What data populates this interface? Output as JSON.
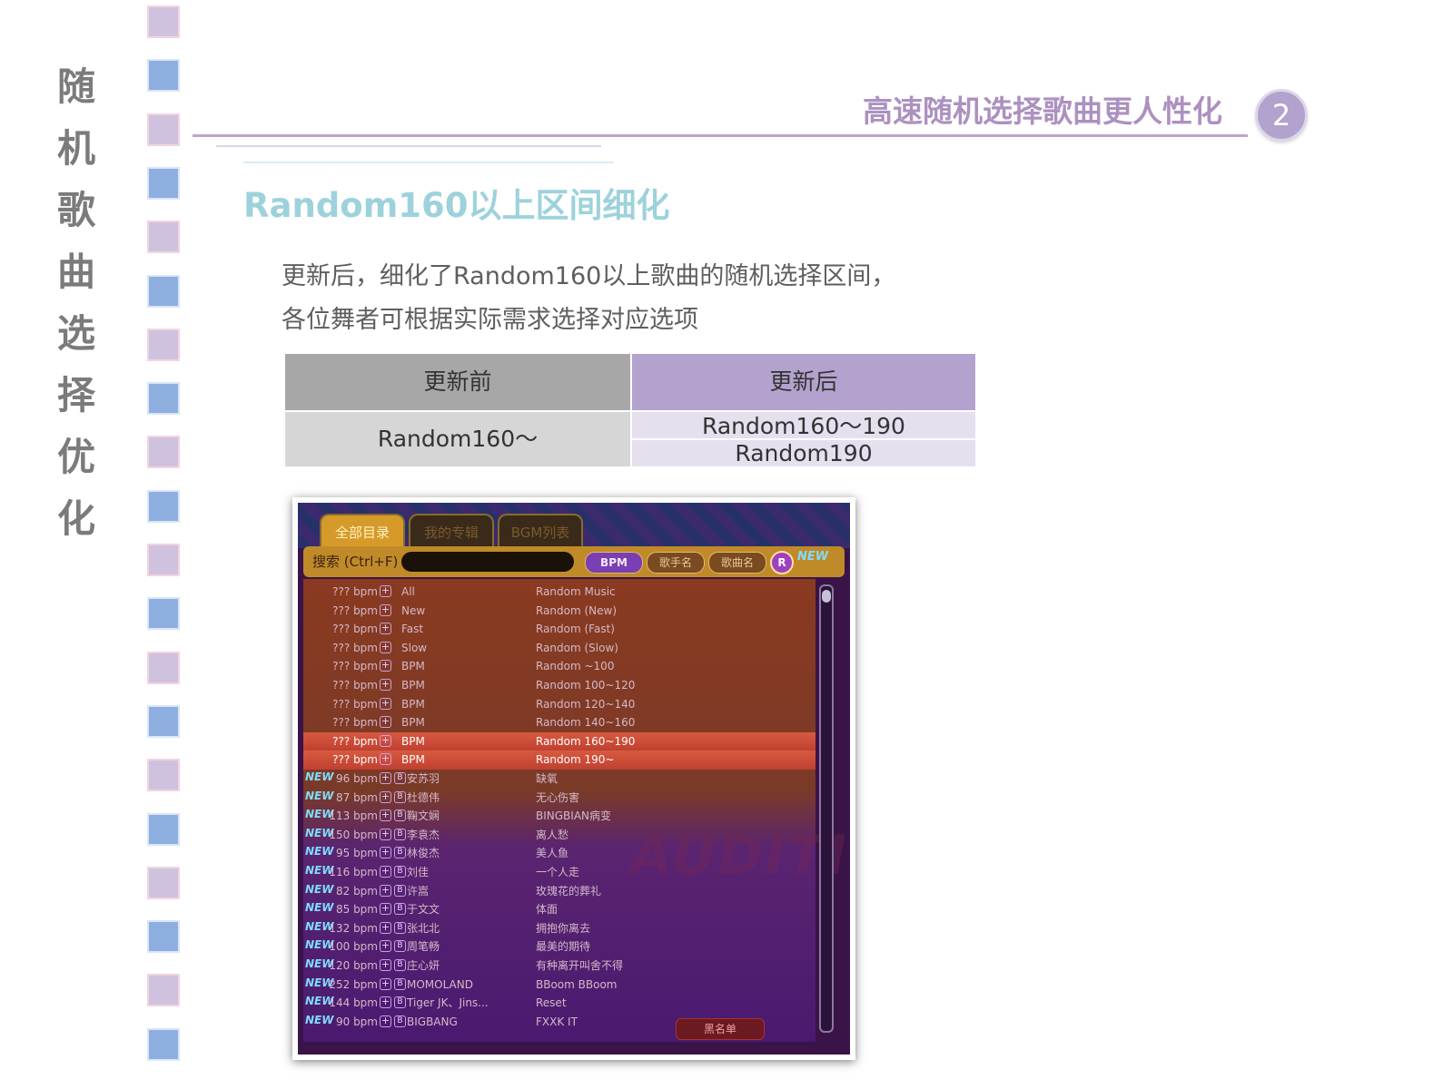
{
  "side_title": [
    "随",
    "机",
    "歌",
    "曲",
    "选",
    "择",
    "优",
    "化"
  ],
  "header": {
    "title": "高速随机选择歌曲更人性化",
    "page_number": "2"
  },
  "section": {
    "heading": "Random160以上区间细化",
    "description_lines": [
      "更新后，细化了Random160以上歌曲的随机选择区间，",
      "各位舞者可根据实际需求选择对应选项"
    ]
  },
  "table": {
    "header_before": "更新前",
    "header_after": "更新后",
    "before_value": "Random160～",
    "after_values": [
      "Random160～190",
      "Random190"
    ]
  },
  "game": {
    "tabs": [
      "全部目录",
      "我的专辑",
      "BGM列表"
    ],
    "active_tab": 0,
    "search_label": "搜索 (Ctrl+F)",
    "sort_buttons": [
      "BPM",
      "歌手名",
      "歌曲名"
    ],
    "r_icon": "R",
    "new_badge": "NEW",
    "watermark": "AUDITION",
    "blacklist_label": "黑名单",
    "songs": [
      {
        "new": false,
        "bpm": "??? bpm",
        "artist": "All",
        "title": "Random Music",
        "selected": false,
        "b": false
      },
      {
        "new": false,
        "bpm": "??? bpm",
        "artist": "New",
        "title": "Random (New)",
        "selected": false,
        "b": false
      },
      {
        "new": false,
        "bpm": "??? bpm",
        "artist": "Fast",
        "title": "Random (Fast)",
        "selected": false,
        "b": false
      },
      {
        "new": false,
        "bpm": "??? bpm",
        "artist": "Slow",
        "title": "Random (Slow)",
        "selected": false,
        "b": false
      },
      {
        "new": false,
        "bpm": "??? bpm",
        "artist": "BPM",
        "title": "Random ~100",
        "selected": false,
        "b": false
      },
      {
        "new": false,
        "bpm": "??? bpm",
        "artist": "BPM",
        "title": "Random 100~120",
        "selected": false,
        "b": false
      },
      {
        "new": false,
        "bpm": "??? bpm",
        "artist": "BPM",
        "title": "Random 120~140",
        "selected": false,
        "b": false
      },
      {
        "new": false,
        "bpm": "??? bpm",
        "artist": "BPM",
        "title": "Random 140~160",
        "selected": false,
        "b": false
      },
      {
        "new": false,
        "bpm": "??? bpm",
        "artist": "BPM",
        "title": "Random 160~190",
        "selected": true,
        "b": false
      },
      {
        "new": false,
        "bpm": "??? bpm",
        "artist": "BPM",
        "title": "Random 190~",
        "selected": true,
        "b": false
      },
      {
        "new": true,
        "bpm": "96 bpm",
        "artist": "安苏羽",
        "title": "缺氧",
        "selected": false,
        "b": true
      },
      {
        "new": true,
        "bpm": "87 bpm",
        "artist": "杜德伟",
        "title": "无心伤害",
        "selected": false,
        "b": true
      },
      {
        "new": true,
        "bpm": "113 bpm",
        "artist": "鞠文娴",
        "title": "BINGBIAN病变",
        "selected": false,
        "b": true
      },
      {
        "new": true,
        "bpm": "150 bpm",
        "artist": "李袁杰",
        "title": "离人愁",
        "selected": false,
        "b": true
      },
      {
        "new": true,
        "bpm": "95 bpm",
        "artist": "林俊杰",
        "title": "美人鱼",
        "selected": false,
        "b": true
      },
      {
        "new": true,
        "bpm": "116 bpm",
        "artist": "刘佳",
        "title": "一个人走",
        "selected": false,
        "b": true
      },
      {
        "new": true,
        "bpm": "82 bpm",
        "artist": "许嵩",
        "title": "玫瑰花的葬礼",
        "selected": false,
        "b": true
      },
      {
        "new": true,
        "bpm": "85 bpm",
        "artist": "于文文",
        "title": "体面",
        "selected": false,
        "b": true
      },
      {
        "new": true,
        "bpm": "132 bpm",
        "artist": "张北北",
        "title": "拥抱你离去",
        "selected": false,
        "b": true
      },
      {
        "new": true,
        "bpm": "100 bpm",
        "artist": "周笔畅",
        "title": "最美的期待",
        "selected": false,
        "b": true
      },
      {
        "new": true,
        "bpm": "120 bpm",
        "artist": "庄心妍",
        "title": "有种离开叫舍不得",
        "selected": false,
        "b": true
      },
      {
        "new": true,
        "bpm": "252 bpm",
        "artist": "MOMOLAND",
        "title": "BBoom BBoom",
        "selected": false,
        "b": true
      },
      {
        "new": true,
        "bpm": "144 bpm",
        "artist": "Tiger JK、Jins...",
        "title": "Reset",
        "selected": false,
        "b": true
      },
      {
        "new": true,
        "bpm": "90 bpm",
        "artist": "BIGBANG",
        "title": "FXXK IT",
        "selected": false,
        "b": true
      }
    ]
  }
}
